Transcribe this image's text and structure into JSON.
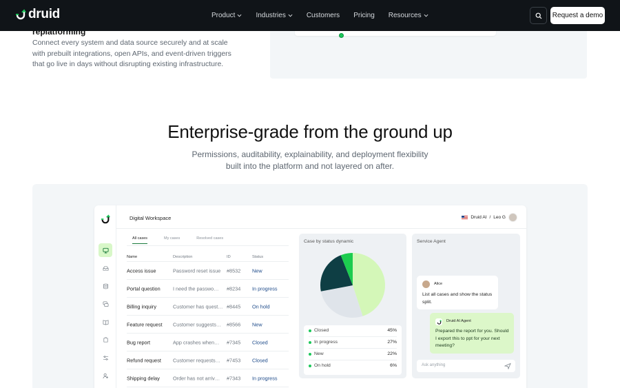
{
  "nav": {
    "brand": "druid",
    "menu": [
      {
        "label": "Product",
        "has_dropdown": true
      },
      {
        "label": "Industries",
        "has_dropdown": true
      },
      {
        "label": "Customers",
        "has_dropdown": false
      },
      {
        "label": "Pricing",
        "has_dropdown": false
      },
      {
        "label": "Resources",
        "has_dropdown": true
      }
    ],
    "cta": "Request a demo",
    "search_icon": "search-icon"
  },
  "fragment": {
    "title": "replatforming",
    "body": "Connect every system and data source securely and at scale with prebuilt integrations, open APIs, and event-driven triggers that go live in days without disrupting existing infrastructure."
  },
  "section": {
    "headline": "Enterprise-grade from the ground up",
    "subhead": "Permissions, auditability, explainability, and deployment flexibility built into the platform and not layered on after."
  },
  "app": {
    "workspace_title": "Digital Workspace",
    "user_label": "Druid AI",
    "user_sep": "/",
    "user_name": "Leo G",
    "tabs": [
      "All cases",
      "My cases",
      "Resolved cases"
    ],
    "columns": [
      "Name",
      "Description",
      "ID",
      "Status"
    ],
    "rows": [
      {
        "name": "Access issue",
        "desc": "Password reset issue",
        "id": "#8532",
        "status": "New"
      },
      {
        "name": "Portal question",
        "desc": "I need the passwo…",
        "id": "#8234",
        "status": "In progress"
      },
      {
        "name": "Billing inquiry",
        "desc": "Customer has quest…",
        "id": "#8445",
        "status": "On hold"
      },
      {
        "name": "Feature request",
        "desc": "Customer suggests…",
        "id": "#8566",
        "status": "New"
      },
      {
        "name": "Bug report",
        "desc": "App crashes when…",
        "id": "#7345",
        "status": "Closed"
      },
      {
        "name": "Refund request",
        "desc": "Customer requests…",
        "id": "#7453",
        "status": "Closed"
      },
      {
        "name": "Shipping delay",
        "desc": "Order has not arriv…",
        "id": "#7343",
        "status": "In progress"
      }
    ],
    "pie": {
      "title": "Case by status dynamic",
      "colors": {
        "Closed": "#d4f7b8",
        "In progress": "#dfe4ea",
        "New": "#0e3e44",
        "On hold": "#1ccc4f"
      },
      "legend": [
        {
          "label": "Closed",
          "value": "45%",
          "pct": 45
        },
        {
          "label": "In progress",
          "value": "27%",
          "pct": 27
        },
        {
          "label": "New",
          "value": "22%",
          "pct": 22
        },
        {
          "label": "On hold",
          "value": "6%",
          "pct": 6
        }
      ]
    },
    "agent": {
      "title": "Service Agent",
      "user_name": "Alice",
      "user_message": "List all cases and show the status split.",
      "bot_name": "Druid AI Agent",
      "bot_message": "Prepared the report for you. Should I export this to ppt for your next meeting?",
      "input_placeholder": "Ask anything"
    }
  }
}
